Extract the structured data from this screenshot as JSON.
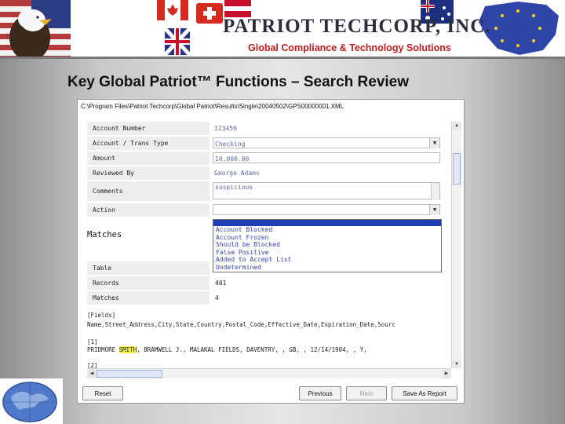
{
  "header": {
    "company_name": "PATRIOT TECHCORP, INC.",
    "tagline": "Global Compliance & Technology Solutions"
  },
  "slide_title": "Key Global Patriot™ Functions – Search Review",
  "window": {
    "file_path": "C:\\Program Files\\Patriot Techcorp\\Global Patriot\\Results\\Single\\20040502\\GPS00000001.XML",
    "form": [
      {
        "label": "Account Number",
        "value": "123456"
      },
      {
        "label": "Account / Trans Type",
        "value": "Checking"
      },
      {
        "label": "Amount",
        "value": "10,000.00"
      },
      {
        "label": "Reviewed By",
        "value": "George Adams"
      },
      {
        "label": "Comments",
        "value": "suspicious"
      },
      {
        "label": "Action",
        "value": ""
      }
    ],
    "action_options": [
      "",
      "Account Blocked",
      "Account Frozen",
      "Should be Blocked",
      "False Positive",
      "Added to Accept List",
      "Undetermined"
    ],
    "matches_title": "Matches",
    "matches_table": [
      {
        "label": "Table",
        "value": ""
      },
      {
        "label": "Records",
        "value": "401"
      },
      {
        "label": "Matches",
        "value": "4"
      }
    ],
    "raw": {
      "fields_header": "[Fields]",
      "fields_line": "Name,Street_Address,City,State,Country,Postal_Code,Effective_Date,Expiration_Date,Sourc",
      "rec1_header": "[1]",
      "rec1_prefix": "PRIDMORE ",
      "rec1_highlight": "SMITH",
      "rec1_suffix": ", BRAMWELL J., MALAKAL FIELDS, DAVENTRY, , GB, , 12/14/1904, , Y,",
      "rec2_header": "[2]"
    },
    "buttons": {
      "reset": "Reset",
      "previous": "Previous",
      "next": "Next",
      "save": "Save As Report"
    }
  },
  "colors": {
    "tagline": "#c11b1b",
    "dropdown_selection": "#1f3fb8",
    "highlight": "#f7f24a"
  }
}
